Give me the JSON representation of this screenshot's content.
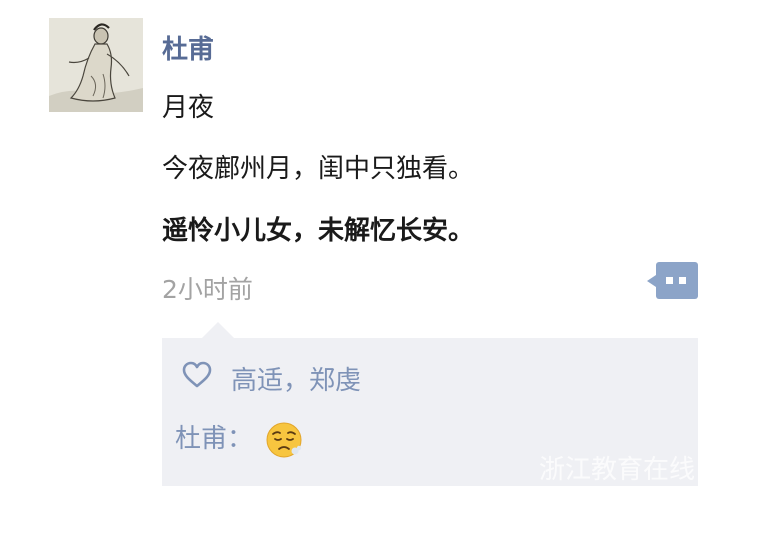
{
  "post": {
    "author": "杜甫",
    "lines": [
      "月夜",
      "今夜鄜州月，闺中只独看。",
      "遥怜小儿女，未解忆长安。"
    ],
    "time": "2小时前"
  },
  "likes": {
    "names": "高适，郑虔"
  },
  "comment": {
    "author_label": "杜甫："
  },
  "watermark": "浙江教育在线",
  "icons": {
    "avatar": "portrait-painting-icon",
    "more": "more-options-icon",
    "like": "heart-icon",
    "emoji": "sad-face-emoji-icon"
  },
  "colors": {
    "name_link": "#576b95",
    "like_link": "#7f93b7",
    "panel_bg": "#eff0f4",
    "more_button": "#8ca4c8",
    "timestamp": "#a3a3a3"
  }
}
